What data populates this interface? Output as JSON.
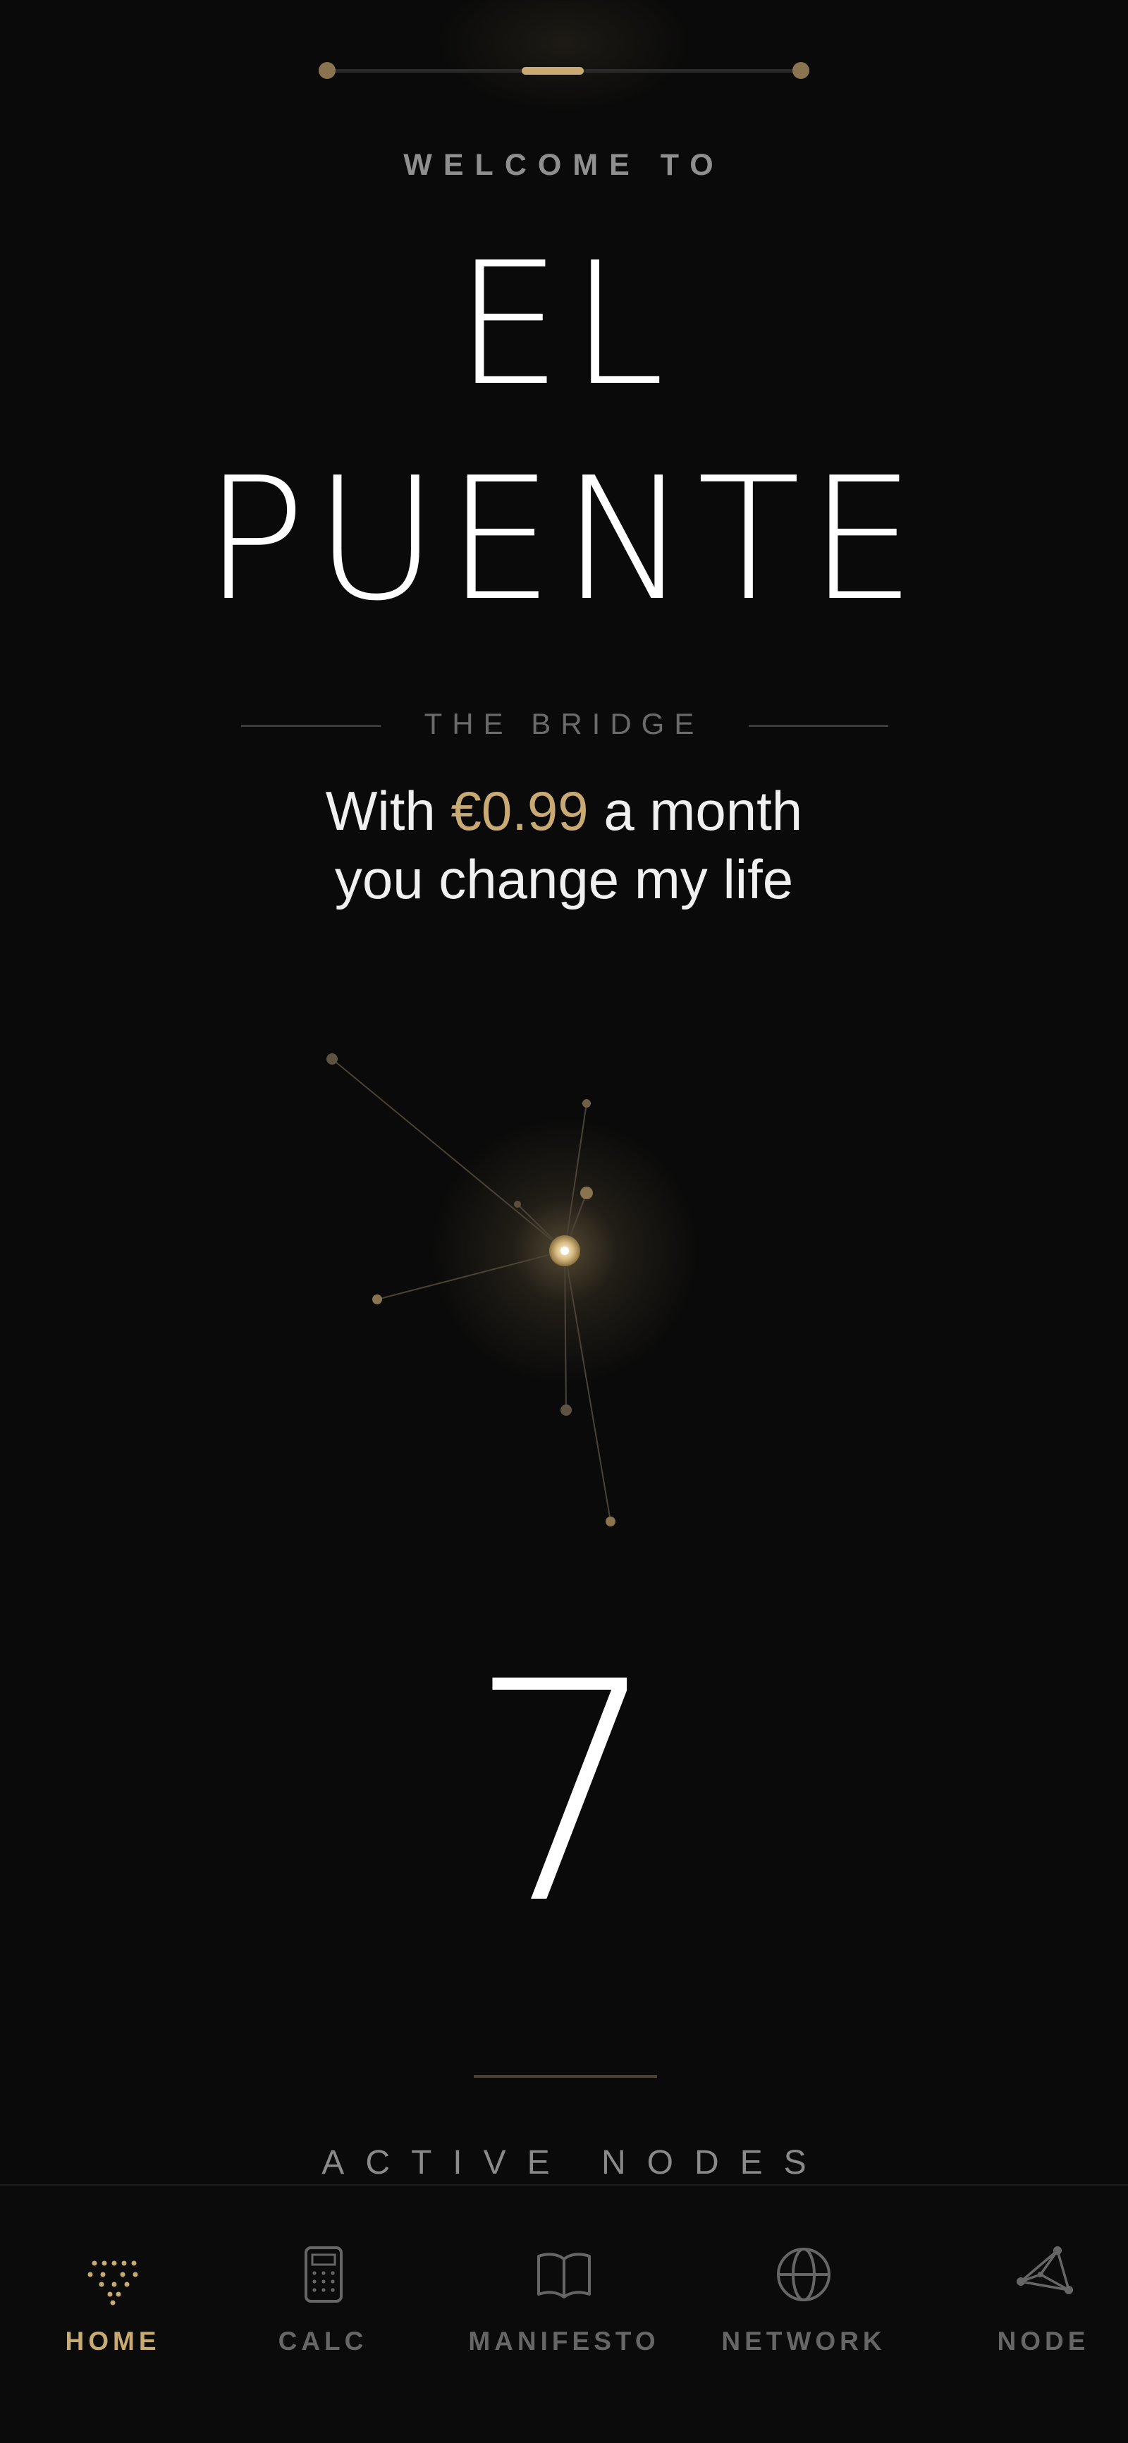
{
  "intro": {
    "welcome": "WELCOME TO",
    "title_line1": "EL",
    "title_line2": "PUENTE",
    "subtitle": "THE BRIDGE",
    "tagline_prefix": "With",
    "tagline_price": "€0.99",
    "tagline_suffix": "a month",
    "tagline_line2": "you change my life"
  },
  "pager": {
    "pages": 3,
    "active_page": 2
  },
  "stats": {
    "active_nodes": "7",
    "active_nodes_label": "ACTIVE NODES"
  },
  "colors": {
    "background": "#0a0a0a",
    "accent_gold": "#c8aa72",
    "text_primary": "#ffffff",
    "text_muted": "#8f8f8f"
  },
  "nav": {
    "items": [
      {
        "label": "HOME",
        "icon": "dots-triangle-icon",
        "active": true
      },
      {
        "label": "CALC",
        "icon": "calculator-icon",
        "active": false
      },
      {
        "label": "MANIFESTO",
        "icon": "book-icon",
        "active": false
      },
      {
        "label": "NETWORK",
        "icon": "globe-icon",
        "active": false
      },
      {
        "label": "NODE",
        "icon": "node-graph-icon",
        "active": false
      }
    ]
  }
}
